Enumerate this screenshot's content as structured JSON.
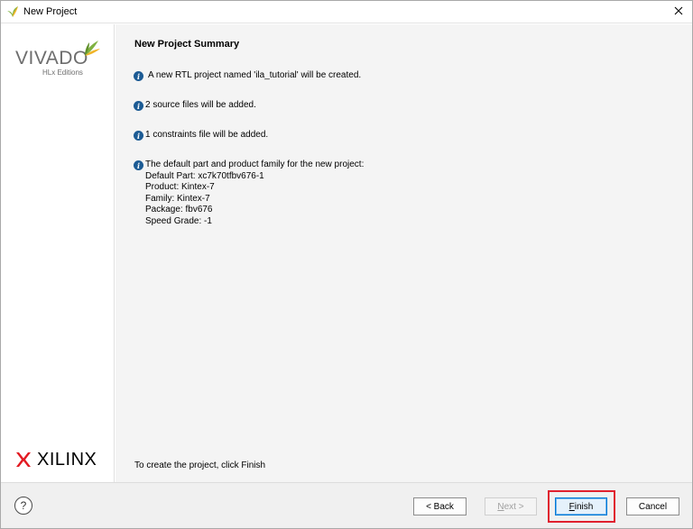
{
  "window": {
    "title": "New Project",
    "icons": {
      "app": "vivado-leaf-icon",
      "close": "close-icon"
    }
  },
  "sidebar": {
    "brand_main": "VIVADO",
    "brand_sub": "HLx Editions",
    "vendor": "XILINX"
  },
  "main": {
    "heading": "New Project Summary",
    "messages": [
      {
        "icon": "info-icon",
        "text": "A new RTL project named 'ila_tutorial' will be created."
      },
      {
        "icon": "info-icon",
        "text": "2 source files will be added."
      },
      {
        "icon": "info-icon",
        "text": "1 constraints file will be added."
      },
      {
        "icon": "info-icon",
        "text": "The default part and product family for the new project:"
      }
    ],
    "details": [
      "Default Part: xc7k70tfbv676-1",
      "Product: Kintex-7",
      "Family: Kintex-7",
      "Package: fbv676",
      "Speed Grade: -1"
    ],
    "footer_hint": "To create the project, click Finish"
  },
  "buttons": {
    "help": "?",
    "back": "< Back",
    "next": "Next >",
    "finish": "Finish",
    "cancel": "Cancel"
  },
  "colors": {
    "info_icon": "#1c5b94",
    "content_bg": "#f4f4f4",
    "highlight": "#e0202e",
    "finish_border": "#0078d7"
  }
}
